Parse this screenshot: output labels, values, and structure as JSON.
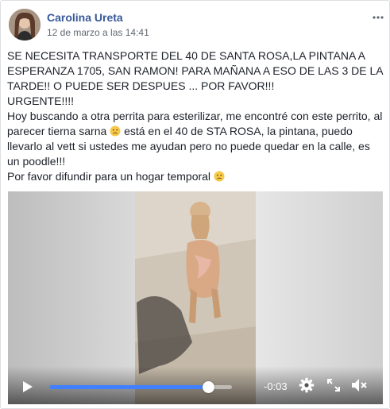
{
  "post": {
    "author": "Carolina Ureta",
    "timestamp": "12 de marzo a las 14:41",
    "more_icon": "more-options-icon",
    "paragraphs": [
      "SE NECESITA TRANSPORTE DEL 40 DE SANTA ROSA,LA PINTANA A ESPERANZA 1705, SAN RAMON! PARA MAÑANA A ESO DE LAS 3 DE LA TARDE!! O PUEDE SER DESPUES ... POR FAVOR!!!",
      "URGENTE!!!!"
    ],
    "paragraph3_before": "Hoy buscando a otra perrita para esterilizar, me encontré con este perrito, al parecer tierna sarna ",
    "paragraph3_after": " está en el 40 de STA ROSA, la pintana, puedo llevarlo al vett si ustedes me ayudan pero no puede quedar en la calle, es un poodle!!!",
    "paragraph4": "Por favor difundir para un hogar temporal ",
    "emoji": "sad-face-emoji"
  },
  "video": {
    "time_remaining": "-0:03",
    "progress": 0.87,
    "icons": [
      "play-icon",
      "settings-gear-icon",
      "fullscreen-icon",
      "volume-muted-icon"
    ]
  }
}
